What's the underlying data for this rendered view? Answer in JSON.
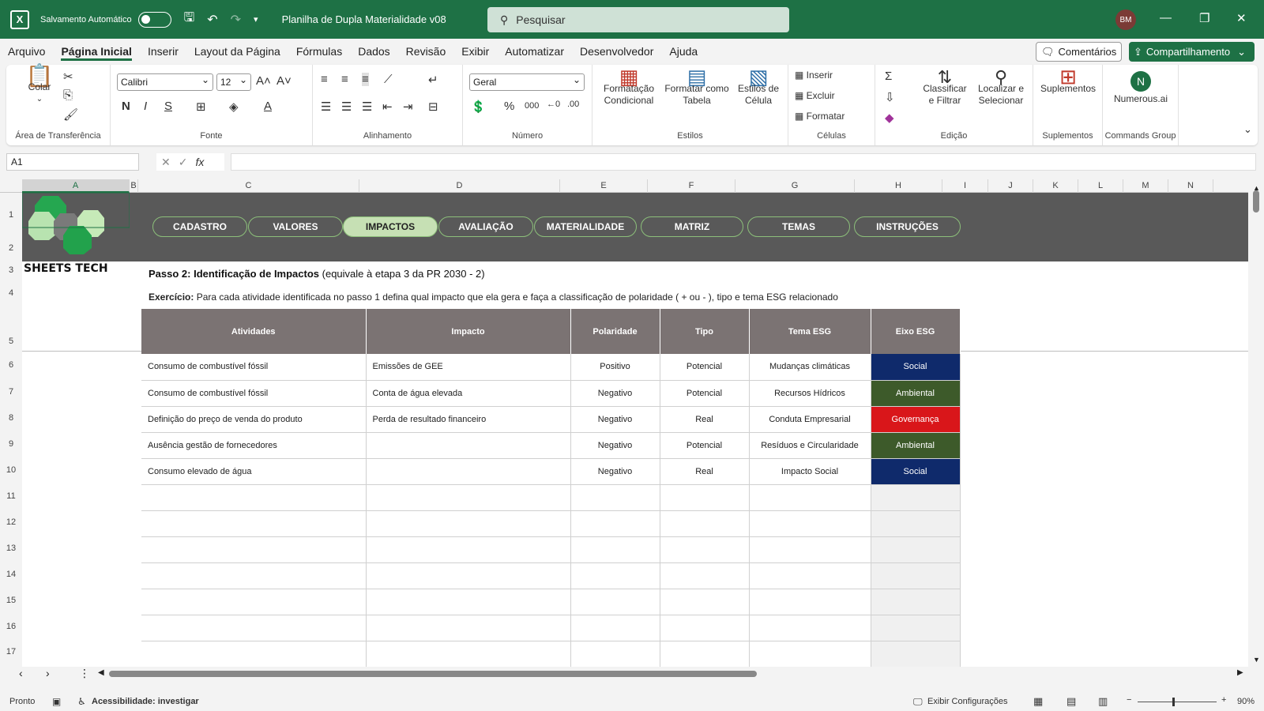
{
  "titlebar": {
    "autosave_label": "Salvamento Automático",
    "doc_title": "Planilha de Dupla Materialidade v08",
    "search_placeholder": "Pesquisar",
    "avatar": "BM"
  },
  "menu": [
    "Arquivo",
    "Página Inicial",
    "Inserir",
    "Layout da Página",
    "Fórmulas",
    "Dados",
    "Revisão",
    "Exibir",
    "Automatizar",
    "Desenvolvedor",
    "Ajuda"
  ],
  "menu_active_index": 1,
  "actions": {
    "comments": "Comentários",
    "share": "Compartilhamento"
  },
  "ribbon": {
    "clipboard": {
      "label": "Área de Transferência",
      "paste": "Colar"
    },
    "font": {
      "label": "Fonte",
      "font_name": "Calibri",
      "font_size": "12"
    },
    "alignment": {
      "label": "Alinhamento"
    },
    "number": {
      "label": "Número",
      "format": "Geral"
    },
    "styles": {
      "label": "Estilos",
      "cond_format_1": "Formatação",
      "cond_format_2": "Condicional",
      "as_table_1": "Formatar como",
      "as_table_2": "Tabela",
      "cell_styles_1": "Estilos de",
      "cell_styles_2": "Célula"
    },
    "cells": {
      "label": "Células",
      "insert": "Inserir",
      "delete": "Excluir",
      "format": "Formatar"
    },
    "editing": {
      "label": "Edição",
      "sort_1": "Classificar",
      "sort_2": "e Filtrar",
      "find_1": "Localizar e",
      "find_2": "Selecionar"
    },
    "addins": {
      "label": "Suplementos",
      "button": "Suplementos"
    },
    "commands": {
      "label": "Commands Group",
      "button": "Numerous.ai"
    }
  },
  "formula_bar": {
    "name_box": "A1",
    "fx": "fx"
  },
  "columns": [
    "A",
    "B",
    "C",
    "D",
    "E",
    "F",
    "G",
    "H",
    "I",
    "J",
    "K",
    "L",
    "M",
    "N"
  ],
  "rows": [
    "1",
    "2",
    "3",
    "4",
    "5",
    "6",
    "7",
    "8",
    "9",
    "10",
    "11",
    "12",
    "13",
    "14",
    "15",
    "16",
    "17"
  ],
  "sheet": {
    "brand": "SHEETS TECH",
    "nav": [
      "CADASTRO",
      "VALORES",
      "IMPACTOS",
      "AVALIAÇÃO",
      "MATERIALIDADE",
      "MATRIZ",
      "TEMAS",
      "INSTRUÇÕES"
    ],
    "nav_active_index": 2,
    "step_title_bold": "Passo 2: Identificação de Impactos",
    "step_title_rest": " (equivale à etapa 3 da PR 2030 - 2)",
    "exercise_bold": "Exercício:",
    "exercise_rest": " Para cada atividade identificada no passo 1 defina qual impacto  que ela gera e faça a classificação de polaridade  ( + ou - ), tipo e tema ESG relacionado",
    "table_headers": [
      "Atividades",
      "Impacto",
      "Polaridade",
      "Tipo",
      "Tema ESG",
      "Eixo ESG"
    ],
    "table_rows": [
      {
        "atividade": "Consumo de combustível fóssil",
        "impacto": "Emissões de GEE",
        "polaridade": "Positivo",
        "tipo": "Potencial",
        "tema": "Mudanças climáticas",
        "eixo": "Social",
        "eixo_color": "#0f2a6b"
      },
      {
        "atividade": "Consumo de combustível fóssil",
        "impacto": "Conta de água elevada",
        "polaridade": "Negativo",
        "tipo": "Potencial",
        "tema": "Recursos Hídricos",
        "eixo": "Ambiental",
        "eixo_color": "#3d5a2a"
      },
      {
        "atividade": "Definição do preço de venda do produto",
        "impacto": "Perda de resultado financeiro",
        "polaridade": "Negativo",
        "tipo": "Real",
        "tema": "Conduta Empresarial",
        "eixo": "Governança",
        "eixo_color": "#d9161a"
      },
      {
        "atividade": "Ausência gestão de fornecedores",
        "impacto": "",
        "polaridade": "Negativo",
        "tipo": "Potencial",
        "tema": "Resíduos e Circularidade",
        "eixo": "Ambiental",
        "eixo_color": "#3d5a2a"
      },
      {
        "atividade": "Consumo elevado de água",
        "impacto": "",
        "polaridade": "Negativo",
        "tipo": "Real",
        "tema": "Impacto Social",
        "eixo": "Social",
        "eixo_color": "#0f2a6b"
      }
    ],
    "empty_rows": 7
  },
  "status": {
    "ready": "Pronto",
    "accessibility": "Acessibilidade: investigar",
    "display_settings": "Exibir Configurações",
    "zoom": "90%"
  }
}
